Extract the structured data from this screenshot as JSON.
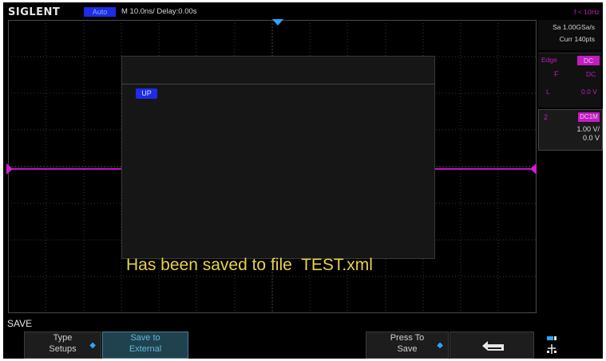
{
  "header": {
    "brand": "SIGLENT",
    "mode": "Auto",
    "timebase": "M 10.0ns/  Delay:0.00s"
  },
  "acquisition": {
    "frequency": "f < 10Hz",
    "sample_rate": "Sa 1.00GSa/s",
    "memory": "Curr 140pts"
  },
  "trigger": {
    "label": "Edge",
    "coupling": "DC",
    "slope_icon": "F",
    "coupling2": "DC",
    "level_label": "L",
    "level": "0.0 V"
  },
  "channel": {
    "number": "2",
    "coupling": "DC1M",
    "scale": "1.00 V/",
    "offset": "0.0 V"
  },
  "dialog": {
    "up_item": "UP"
  },
  "message": "Has been saved to file  TEST.xml",
  "menu": {
    "title": "SAVE",
    "softkeys": [
      {
        "line1": "Type",
        "line2": "Setups"
      },
      {
        "line1": "Save to",
        "line2": "External"
      },
      {
        "line1": "Press To",
        "line2": "Save"
      }
    ],
    "back_icon": "return-arrow-icon",
    "usb_icon": "usb-icon"
  },
  "colors": {
    "channel2": "#c11dc1",
    "highlight": "#1f2be6",
    "message": "#e8d24a",
    "trigger_marker": "#2aa7ff"
  }
}
